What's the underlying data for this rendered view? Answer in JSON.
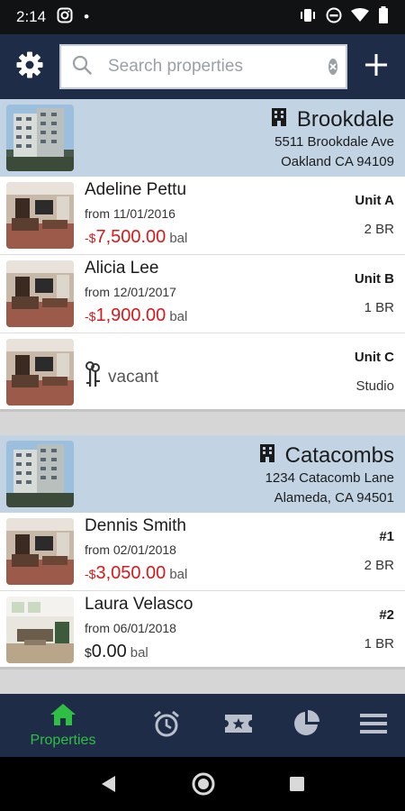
{
  "status_bar": {
    "time": "2:14",
    "dot": "•"
  },
  "search": {
    "placeholder": "Search properties",
    "value": ""
  },
  "properties": [
    {
      "name": "Brookdale",
      "address_line1": "5511 Brookdale Ave",
      "address_line2": "Oakland CA 94109",
      "units": [
        {
          "tenant": "Adeline Pettu",
          "from": "from 11/01/2016",
          "bal_prefix": "-$",
          "balance": "7,500.00",
          "bal_suffix": "bal",
          "unit": "Unit A",
          "size": "2 BR"
        },
        {
          "tenant": "Alicia Lee",
          "from": "from 12/01/2017",
          "bal_prefix": "-$",
          "balance": "1,900.00",
          "bal_suffix": "bal",
          "unit": "Unit B",
          "size": "1 BR"
        },
        {
          "vacant_label": "vacant",
          "unit": "Unit C",
          "size": "Studio"
        }
      ]
    },
    {
      "name": "Catacombs",
      "address_line1": "1234 Catacomb Lane",
      "address_line2": "Alameda, CA 94501",
      "units": [
        {
          "tenant": "Dennis Smith",
          "from": "from 02/01/2018",
          "bal_prefix": "-$",
          "balance": "3,050.00",
          "bal_suffix": "bal",
          "unit": "#1",
          "size": "2 BR"
        },
        {
          "tenant": "Laura Velasco",
          "from": "from 06/01/2018",
          "bal_prefix": "$",
          "balance": "0.00",
          "bal_suffix": "bal",
          "unit": "#2",
          "size": "1 BR"
        }
      ]
    }
  ],
  "bottom_nav": {
    "properties_label": "Properties"
  },
  "colors": {
    "header_bg": "#1f2c48",
    "property_header_bg": "#c2d4e4",
    "negative_balance": "#d7191b",
    "active_nav": "#2fbf44"
  },
  "icons": [
    "instagram-icon",
    "vibrate-icon",
    "dnd-icon",
    "wifi-icon",
    "battery-icon",
    "gear-icon",
    "search-icon",
    "clear-icon",
    "plus-icon",
    "building-icon",
    "keys-icon",
    "home-icon",
    "alarm-clock-icon",
    "ticket-star-icon",
    "pie-chart-icon",
    "menu-icon",
    "back-icon",
    "home-circle-icon",
    "recents-icon"
  ]
}
